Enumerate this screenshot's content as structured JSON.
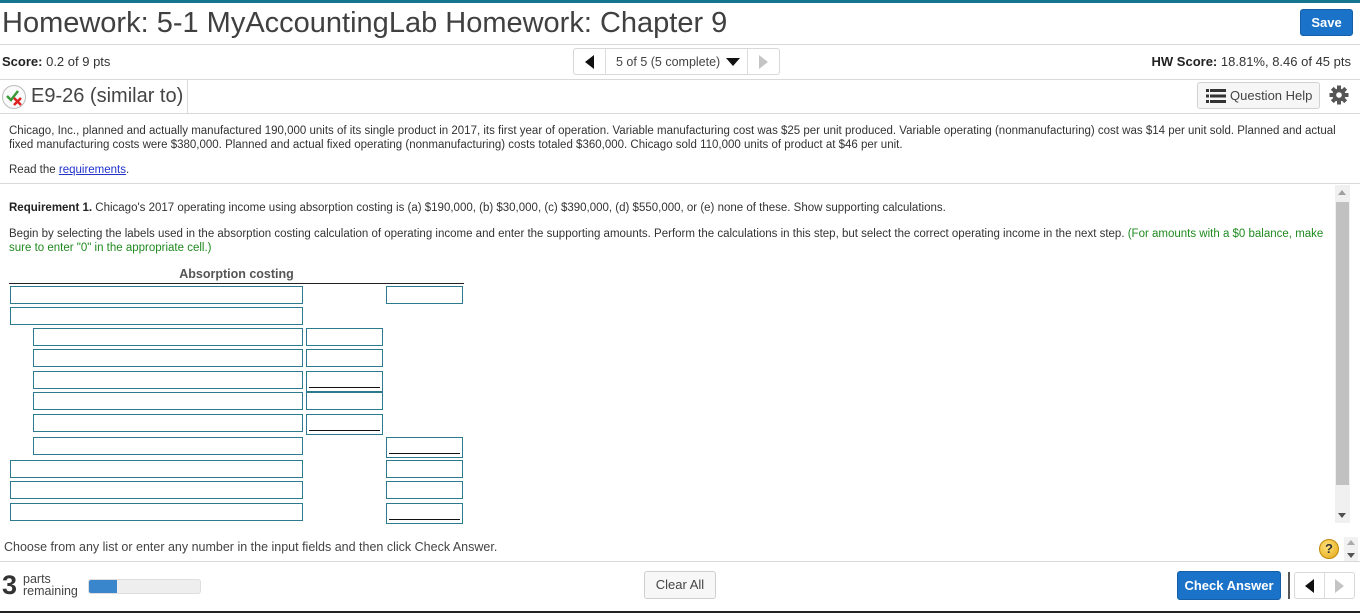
{
  "header": {
    "title": "Homework: 5-1 MyAccountingLab Homework: Chapter 9",
    "save_label": "Save"
  },
  "status_bar": {
    "score_label": "Score:",
    "score_value": "0.2 of 9 pts",
    "question_nav": "5 of 5 (5 complete)",
    "hw_score_label": "HW Score:",
    "hw_score_value": "18.81%, 8.46 of 45 pts"
  },
  "question": {
    "title": "E9-26 (similar to)",
    "status_icon": "partially-correct-icon",
    "help_label": "Question Help",
    "settings_icon": "gear-icon"
  },
  "problem": {
    "text": "Chicago, Inc., planned and actually manufactured 190,000 units of its single product in 2017, its first year of operation. Variable manufacturing cost was $25 per unit produced. Variable operating (nonmanufacturing) cost was $14 per unit sold. Planned and actual fixed manufacturing costs were $380,000. Planned and actual fixed operating (nonmanufacturing) costs totaled $360,000. Chicago sold 110,000 units of product at $46 per unit.",
    "read_prefix": "Read the ",
    "read_link": "requirements",
    "read_suffix": "."
  },
  "requirement": {
    "label": "Requirement 1.",
    "text": " Chicago's 2017 operating income using absorption costing is (a) $190,000, (b) $30,000, (c) $390,000, (d) $550,000, or (e) none of these. Show supporting calculations.",
    "instructions": "Begin by selecting the labels used in the absorption costing calculation of operating income and enter the supporting amounts. Perform the calculations in this step, but select the correct operating income in the next step. ",
    "note": "(For amounts with a $0 balance, make sure to enter \"0\" in the appropriate cell.)"
  },
  "table": {
    "header": "Absorption costing",
    "rows": [
      {
        "label_value": "",
        "mid_value": null,
        "right_value": ""
      },
      {
        "label_value": "",
        "mid_value": null,
        "right_value": null
      },
      {
        "label_value": "",
        "mid_value": "",
        "right_value": null
      },
      {
        "label_value": "",
        "mid_value": "",
        "right_value": null
      },
      {
        "label_value": "",
        "mid_value": "",
        "right_value": null
      },
      {
        "label_value": "",
        "mid_value": "",
        "right_value": null
      },
      {
        "label_value": "",
        "mid_value": "",
        "right_value": null
      },
      {
        "label_value": "",
        "mid_value": null,
        "right_value": ""
      },
      {
        "label_value": "",
        "mid_value": null,
        "right_value": ""
      },
      {
        "label_value": "",
        "mid_value": null,
        "right_value": ""
      },
      {
        "label_value": "",
        "mid_value": null,
        "right_value": ""
      }
    ]
  },
  "footer": {
    "instruction": "Choose from any list or enter any number in the input fields and then click Check Answer.",
    "parts_remaining": "3",
    "parts_label_1": "parts",
    "parts_label_2": "remaining",
    "progress_fraction": 0.25,
    "clear_all_label": "Clear All",
    "check_answer_label": "Check Answer",
    "help_glyph": "?"
  },
  "colors": {
    "accent": "#1a73c8",
    "input_border": "#2b7a8e",
    "note_green": "#1f8a1f",
    "top_strip": "#16758e"
  }
}
